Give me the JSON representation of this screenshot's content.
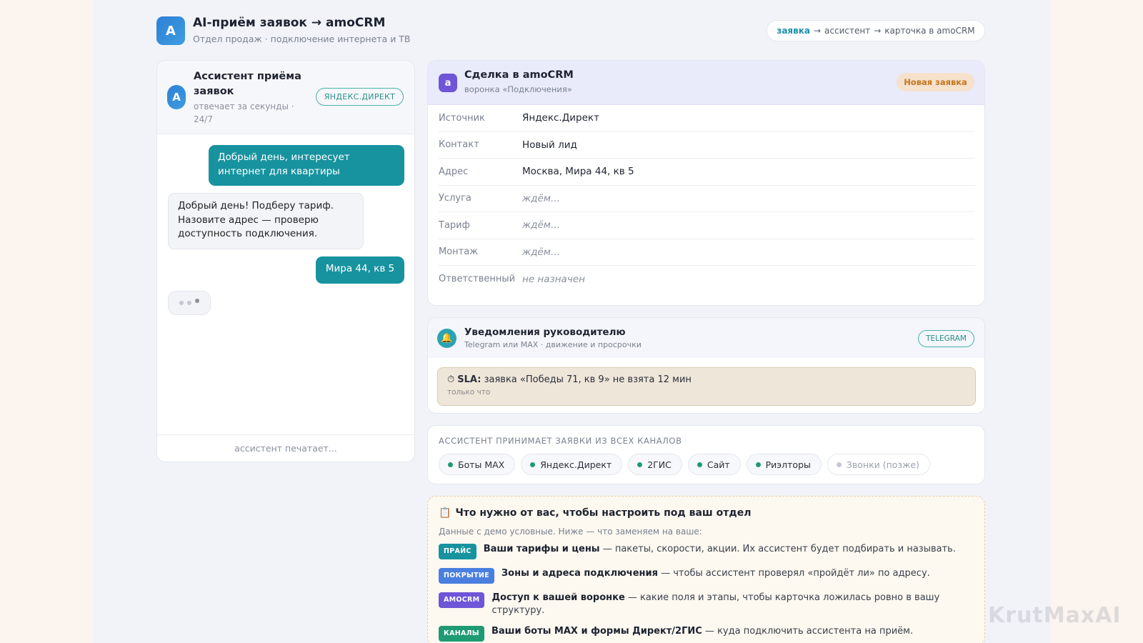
{
  "header": {
    "logo_letter": "A",
    "title": "AI-приём заявок → amoCRM",
    "subtitle": "Отдел продаж · подключение интернета и ТВ",
    "flow": {
      "step1": "заявка",
      "arrow1": "→",
      "step2": "ассистент",
      "arrow2": "→",
      "step3": "карточка в amoCRM"
    }
  },
  "chat": {
    "avatar_letter": "A",
    "title": "Ассистент приёма заявок",
    "subtitle": "отвечает за секунды · 24/7",
    "source_badge": "ЯНДЕКС.ДИРЕКТ",
    "messages": [
      {
        "from": "user",
        "text": "Добрый день, интересует интернет для квартиры"
      },
      {
        "from": "bot",
        "text": "Добрый день! Подберу тариф. Назовите адрес — проверю доступность подключения."
      },
      {
        "from": "user",
        "text": "Мира 44, кв 5"
      }
    ],
    "footer": "ассистент печатает..."
  },
  "deal": {
    "icon_letter": "a",
    "title": "Сделка в amoCRM",
    "subtitle": "воронка «Подключения»",
    "status": "Новая заявка",
    "rows": [
      {
        "key": "Источник",
        "value": "Яндекс.Директ",
        "pending": false
      },
      {
        "key": "Контакт",
        "value": "Новый лид",
        "pending": false
      },
      {
        "key": "Адрес",
        "value": "Москва, Мира 44, кв 5",
        "pending": false
      },
      {
        "key": "Услуга",
        "value": "ждём...",
        "pending": true
      },
      {
        "key": "Тариф",
        "value": "ждём...",
        "pending": true
      },
      {
        "key": "Монтаж",
        "value": "ждём...",
        "pending": true
      },
      {
        "key": "Ответственный",
        "value": "не назначен",
        "pending": true
      }
    ]
  },
  "notifications": {
    "icon": "bell-icon",
    "title": "Уведомления руководителю",
    "subtitle": "Telegram или MAX · движение и просрочки",
    "badge": "TELEGRAM",
    "sla": {
      "icon": "⏱",
      "label": "SLA:",
      "text": "заявка «Победы 71, кв 9» не взята 12 мин",
      "time": "только что"
    }
  },
  "channels": {
    "title": "АССИСТЕНТ ПРИНИМАЕТ ЗАЯВКИ ИЗ ВСЕХ КАНАЛОВ",
    "items": [
      {
        "label": "Боты MAX",
        "active": true
      },
      {
        "label": "Яндекс.Директ",
        "active": true
      },
      {
        "label": "2ГИС",
        "active": true
      },
      {
        "label": "Сайт",
        "active": true
      },
      {
        "label": "Риэлторы",
        "active": true
      },
      {
        "label": "Звонки (позже)",
        "active": false
      }
    ]
  },
  "requirements": {
    "icon": "📋",
    "title": "Что нужно от вас, чтобы настроить под ваш отдел",
    "subtitle": "Данные с демо условные. Ниже — что заменяем на ваше:",
    "items": [
      {
        "tag": "ПРАЙС",
        "color": "#17939f",
        "bold": "Ваши тарифы и цены",
        "text": " — пакеты, скорости, акции. Их ассистент будет подбирать и называть."
      },
      {
        "tag": "ПОКРЫТИЕ",
        "color": "#4a7fe0",
        "bold": "Зоны и адреса подключения",
        "text": " — чтобы ассистент проверял «пройдёт ли» по адресу."
      },
      {
        "tag": "AMOCRM",
        "color": "#6f55d7",
        "bold": "Доступ к вашей воронке",
        "text": " — какие поля и этапы, чтобы карточка ложилась ровно в вашу структуру."
      },
      {
        "tag": "КАНАЛЫ",
        "color": "#1f9b74",
        "bold": "Ваши боты MAX и формы Директ/2ГИС",
        "text": " — куда подключить ассистента на приём."
      }
    ]
  },
  "watermark": "KrutMaxAI"
}
